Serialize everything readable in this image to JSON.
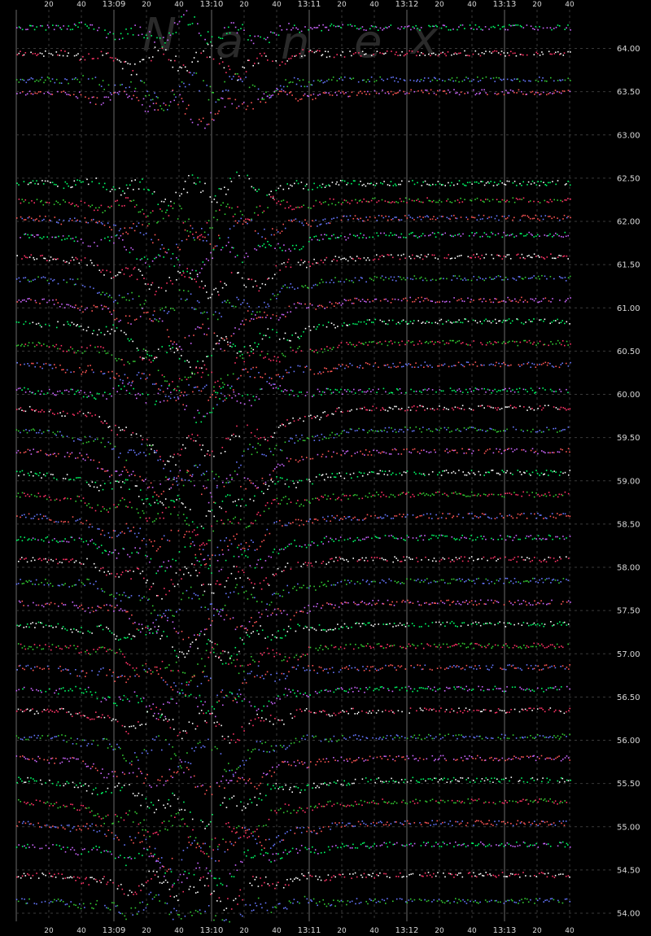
{
  "chart_data": {
    "type": "scatter",
    "title": "",
    "xlabel": "",
    "ylabel": "",
    "watermark_letters": [
      "N",
      "a",
      "n",
      "e",
      "x"
    ],
    "x_tick_labels": [
      "20",
      "40",
      "13:09",
      "20",
      "40",
      "13:10",
      "20",
      "40",
      "13:11",
      "20",
      "40",
      "13:12",
      "20",
      "40",
      "13:13",
      "20",
      "40"
    ],
    "y_tick_labels": [
      "64.00",
      "63.50",
      "63.00",
      "62.50",
      "62.00",
      "61.50",
      "61.00",
      "60.50",
      "60.00",
      "59.50",
      "59.00",
      "58.50",
      "58.00",
      "57.50",
      "57.00",
      "56.50",
      "56.00",
      "55.50",
      "55.00",
      "54.50",
      "54.00"
    ],
    "ylim": [
      53.98,
      64.6
    ],
    "x_seconds_range": [
      0,
      340
    ],
    "grid": true,
    "colors": {
      "background": "#000000",
      "grid": "#3a3a3a",
      "major_grid": "#6a6a6a",
      "dots": [
        "#00ff66",
        "#ff3366",
        "#6677ff",
        "#cc66ff",
        "#ffffff",
        "#33cc33",
        "#ff5555"
      ]
    },
    "series": [
      {
        "base": 64.25,
        "dip": 0.08
      },
      {
        "base": 63.95,
        "dip": 0.12
      },
      {
        "base": 63.65,
        "dip": 0.15
      },
      {
        "base": 63.5,
        "dip": 0.18
      },
      {
        "base": 62.45,
        "dip": 0.1
      },
      {
        "base": 62.25,
        "dip": 0.2
      },
      {
        "base": 62.05,
        "dip": 0.25
      },
      {
        "base": 61.85,
        "dip": 0.3
      },
      {
        "base": 61.6,
        "dip": 0.35
      },
      {
        "base": 61.35,
        "dip": 0.4
      },
      {
        "base": 61.1,
        "dip": 0.4
      },
      {
        "base": 60.85,
        "dip": 0.4
      },
      {
        "base": 60.6,
        "dip": 0.35
      },
      {
        "base": 60.35,
        "dip": 0.3
      },
      {
        "base": 60.05,
        "dip": 0.1
      },
      {
        "base": 59.85,
        "dip": 0.5
      },
      {
        "base": 59.6,
        "dip": 0.5
      },
      {
        "base": 59.35,
        "dip": 0.45
      },
      {
        "base": 59.1,
        "dip": 0.4
      },
      {
        "base": 58.85,
        "dip": 0.35
      },
      {
        "base": 58.6,
        "dip": 0.35
      },
      {
        "base": 58.35,
        "dip": 0.3
      },
      {
        "base": 58.1,
        "dip": 0.3
      },
      {
        "base": 57.85,
        "dip": 0.3
      },
      {
        "base": 57.6,
        "dip": 0.3
      },
      {
        "base": 57.35,
        "dip": 0.25
      },
      {
        "base": 57.1,
        "dip": 0.25
      },
      {
        "base": 56.85,
        "dip": 0.2
      },
      {
        "base": 56.6,
        "dip": 0.2
      },
      {
        "base": 56.35,
        "dip": 0.2
      },
      {
        "base": 56.05,
        "dip": 0.25
      },
      {
        "base": 55.8,
        "dip": 0.3
      },
      {
        "base": 55.55,
        "dip": 0.35
      },
      {
        "base": 55.3,
        "dip": 0.4
      },
      {
        "base": 55.05,
        "dip": 0.35
      },
      {
        "base": 54.8,
        "dip": 0.3
      },
      {
        "base": 54.45,
        "dip": 0.2
      },
      {
        "base": 54.15,
        "dip": 0.15
      }
    ]
  }
}
